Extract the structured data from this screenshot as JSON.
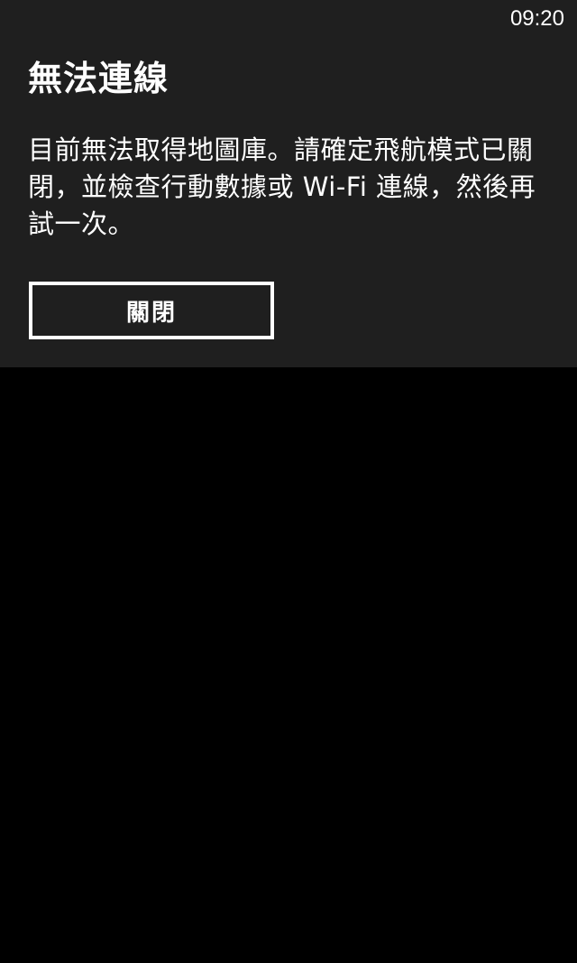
{
  "status_bar": {
    "time": "09:20"
  },
  "dialog": {
    "title": "無法連線",
    "message": "目前無法取得地圖庫。請確定飛航模式已關閉，並檢查行動數據或 Wi-Fi 連線，然後再試一次。",
    "close_label": "關閉"
  },
  "colors": {
    "dialog_background": "#1f1f1f",
    "screen_background": "#000000",
    "text": "#ffffff"
  }
}
